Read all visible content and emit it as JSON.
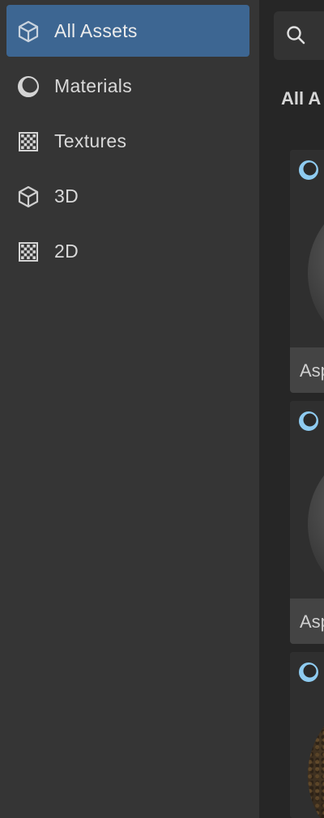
{
  "sidebar": {
    "items": [
      {
        "label": "All Assets",
        "icon": "cube-icon",
        "active": true
      },
      {
        "label": "Materials",
        "icon": "sphere-icon",
        "active": false
      },
      {
        "label": "Textures",
        "icon": "checker-icon",
        "active": false
      },
      {
        "label": "3D",
        "icon": "cube-icon",
        "active": false
      },
      {
        "label": "2D",
        "icon": "checker-icon",
        "active": false
      }
    ]
  },
  "main": {
    "search": {
      "icon": "search-icon",
      "placeholder": ""
    },
    "section_title": "All A",
    "cards": [
      {
        "label": "Asp",
        "badge_icon": "material-badge-icon",
        "preview": "gray-sphere"
      },
      {
        "label": "Asp",
        "badge_icon": "material-badge-icon",
        "preview": "gray-sphere"
      },
      {
        "label": "",
        "badge_icon": "material-badge-icon",
        "preview": "dirt-sphere"
      }
    ]
  },
  "colors": {
    "sidebar_bg": "#353535",
    "active_bg": "#3d6692",
    "main_bg": "#262626",
    "badge_accent": "#8ecbf0"
  }
}
